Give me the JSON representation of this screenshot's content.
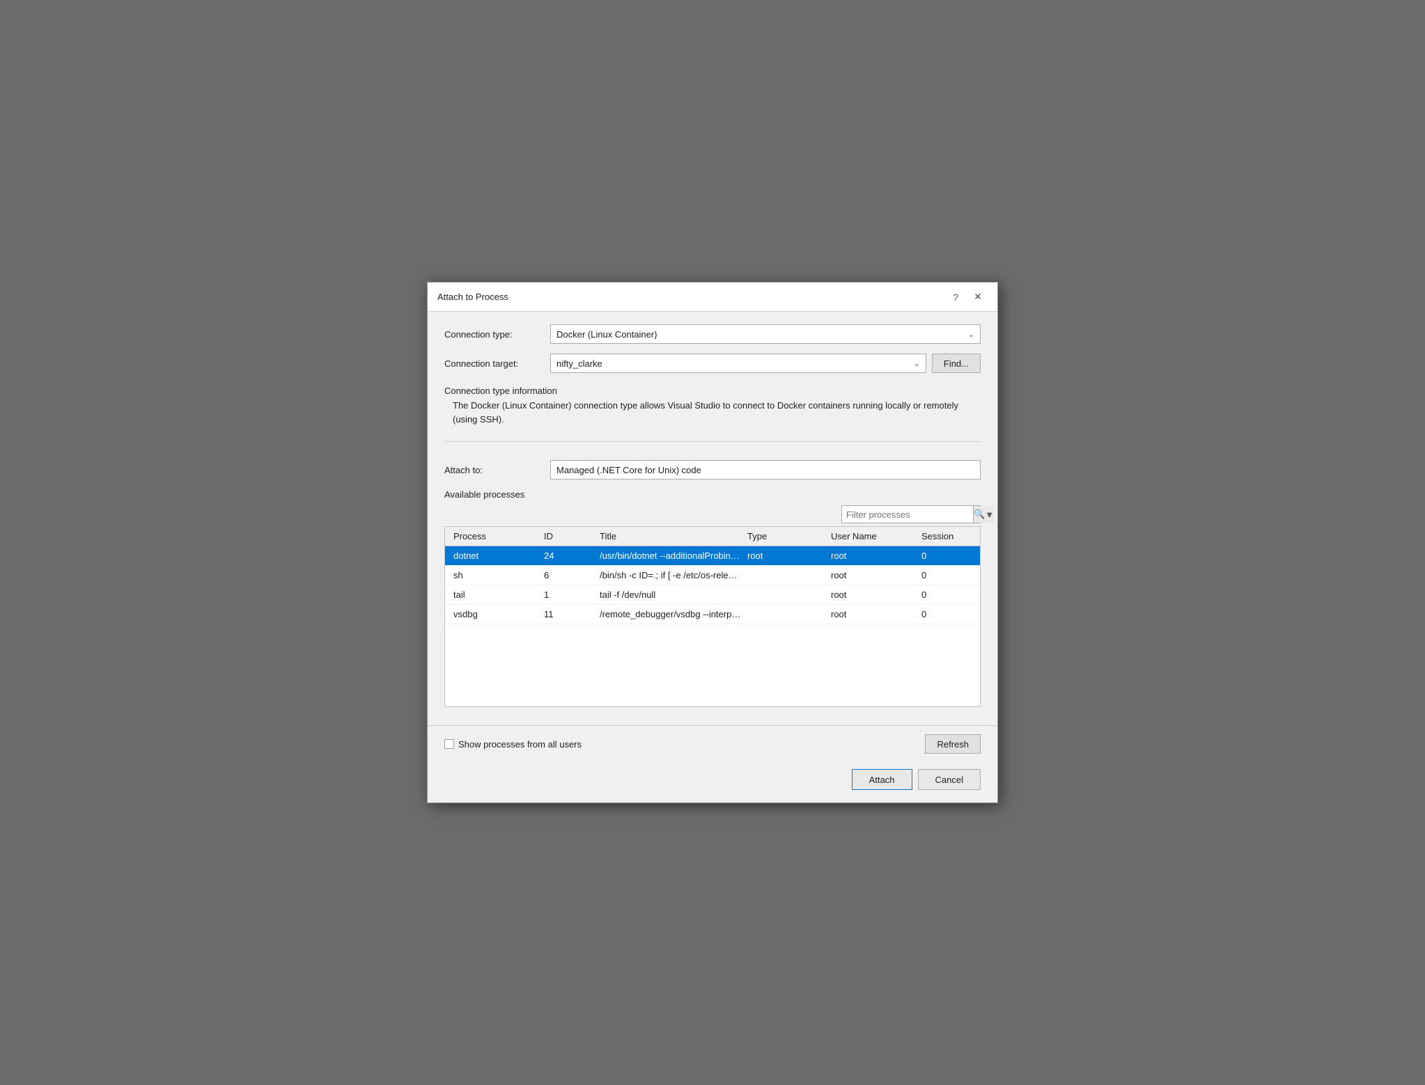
{
  "dialog": {
    "title": "Attach to Process",
    "help_btn": "?",
    "close_btn": "✕"
  },
  "connection_type": {
    "label": "Connection type:",
    "value": "Docker (Linux Container)"
  },
  "connection_target": {
    "label": "Connection target:",
    "value": "nifty_clarke",
    "find_btn": "Find..."
  },
  "connection_info": {
    "label": "Connection type information",
    "text": "The Docker (Linux Container) connection type allows Visual Studio to connect to Docker containers running locally or remotely (using SSH)."
  },
  "attach_to": {
    "label": "Attach to:",
    "value": "Managed (.NET Core for Unix) code"
  },
  "available_processes": {
    "label": "Available processes",
    "filter_placeholder": "Filter processes",
    "columns": [
      "Process",
      "ID",
      "Title",
      "Type",
      "User Name",
      "Session"
    ],
    "rows": [
      {
        "process": "dotnet",
        "id": "24",
        "title": "/usr/bin/dotnet --additionalProbingPath /root...",
        "type": "root",
        "username": "root",
        "session": "0",
        "selected": true
      },
      {
        "process": "sh",
        "id": "6",
        "title": "/bin/sh -c ID=.; if [ -e /etc/os-release ]; then . /...",
        "type": "",
        "username": "root",
        "session": "0",
        "selected": false
      },
      {
        "process": "tail",
        "id": "1",
        "title": "tail -f /dev/null",
        "type": "",
        "username": "root",
        "session": "0",
        "selected": false
      },
      {
        "process": "vsdbg",
        "id": "11",
        "title": "/remote_debugger/vsdbg --interpreter=vscode",
        "type": "",
        "username": "root",
        "session": "0",
        "selected": false
      }
    ]
  },
  "footer": {
    "show_processes_label": "Show processes from all users",
    "refresh_btn": "Refresh",
    "attach_btn": "Attach",
    "cancel_btn": "Cancel"
  }
}
